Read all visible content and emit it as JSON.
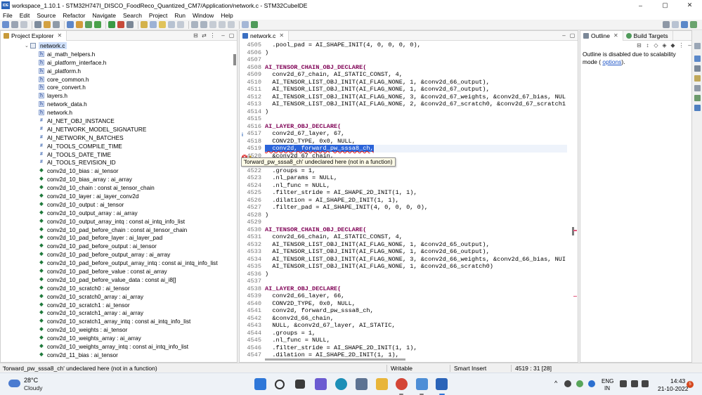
{
  "window": {
    "app_icon_label": "IDE",
    "title": "workspace_1.10.1 - STM32H747I_DISCO_FoodReco_Quantized_CM7/Application/network.c - STM32CubeIDE",
    "controls": [
      "–",
      "▢",
      "✕"
    ]
  },
  "menu": [
    "File",
    "Edit",
    "Source",
    "Refactor",
    "Navigate",
    "Search",
    "Project",
    "Run",
    "Window",
    "Help"
  ],
  "explorer": {
    "tab_label": "Project Explorer",
    "items": [
      {
        "label": "network.c",
        "kind": "file",
        "selected": true
      },
      {
        "label": "ai_math_helpers.h",
        "kind": "include"
      },
      {
        "label": "ai_platform_interface.h",
        "kind": "include"
      },
      {
        "label": "ai_platform.h",
        "kind": "include"
      },
      {
        "label": "core_common.h",
        "kind": "include"
      },
      {
        "label": "core_convert.h",
        "kind": "include"
      },
      {
        "label": "layers.h",
        "kind": "include"
      },
      {
        "label": "network_data.h",
        "kind": "include"
      },
      {
        "label": "network.h",
        "kind": "include"
      },
      {
        "label": "AI_NET_OBJ_INSTANCE",
        "kind": "macro"
      },
      {
        "label": "AI_NETWORK_MODEL_SIGNATURE",
        "kind": "macro"
      },
      {
        "label": "AI_NETWORK_N_BATCHES",
        "kind": "macro"
      },
      {
        "label": "AI_TOOLS_COMPILE_TIME",
        "kind": "macro"
      },
      {
        "label": "AI_TOOLS_DATE_TIME",
        "kind": "macro"
      },
      {
        "label": "AI_TOOLS_REVISION_ID",
        "kind": "macro"
      },
      {
        "label": "conv2d_10_bias : ai_tensor",
        "kind": "var"
      },
      {
        "label": "conv2d_10_bias_array : ai_array",
        "kind": "var"
      },
      {
        "label": "conv2d_10_chain : const ai_tensor_chain",
        "kind": "var"
      },
      {
        "label": "conv2d_10_layer : ai_layer_conv2d",
        "kind": "var"
      },
      {
        "label": "conv2d_10_output : ai_tensor",
        "kind": "var"
      },
      {
        "label": "conv2d_10_output_array : ai_array",
        "kind": "var"
      },
      {
        "label": "conv2d_10_output_array_intq : const ai_intq_info_list",
        "kind": "var"
      },
      {
        "label": "conv2d_10_pad_before_chain : const ai_tensor_chain",
        "kind": "var"
      },
      {
        "label": "conv2d_10_pad_before_layer : ai_layer_pad",
        "kind": "var"
      },
      {
        "label": "conv2d_10_pad_before_output : ai_tensor",
        "kind": "var"
      },
      {
        "label": "conv2d_10_pad_before_output_array : ai_array",
        "kind": "var"
      },
      {
        "label": "conv2d_10_pad_before_output_array_intq : const ai_intq_info_list",
        "kind": "var"
      },
      {
        "label": "conv2d_10_pad_before_value : const ai_array",
        "kind": "var"
      },
      {
        "label": "conv2d_10_pad_before_value_data : const ai_i8[]",
        "kind": "var"
      },
      {
        "label": "conv2d_10_scratch0 : ai_tensor",
        "kind": "var"
      },
      {
        "label": "conv2d_10_scratch0_array : ai_array",
        "kind": "var"
      },
      {
        "label": "conv2d_10_scratch1 : ai_tensor",
        "kind": "var"
      },
      {
        "label": "conv2d_10_scratch1_array : ai_array",
        "kind": "var"
      },
      {
        "label": "conv2d_10_scratch1_array_intq : const ai_intq_info_list",
        "kind": "var"
      },
      {
        "label": "conv2d_10_weights : ai_tensor",
        "kind": "var"
      },
      {
        "label": "conv2d_10_weights_array : ai_array",
        "kind": "var"
      },
      {
        "label": "conv2d_10_weights_array_intq : const ai_intq_info_list",
        "kind": "var"
      },
      {
        "label": "conv2d_11_bias : ai_tensor",
        "kind": "var"
      }
    ]
  },
  "editor": {
    "tab_label": "network.c",
    "hover_tooltip": "'forward_pw_sssa8_ch' undeclared here (not in a function)",
    "lines": [
      {
        "n": "4505",
        "t": "  .pool_pad = AI_SHAPE_INIT(4, 0, 0, 0, 0),"
      },
      {
        "n": "4506",
        "t": ")"
      },
      {
        "n": "4507",
        "t": ""
      },
      {
        "n": "4508",
        "t": "AI_TENSOR_CHAIN_OBJ_DECLARE("
      },
      {
        "n": "4509",
        "t": "  conv2d_67_chain, AI_STATIC_CONST, 4,"
      },
      {
        "n": "4510",
        "t": "  AI_TENSOR_LIST_OBJ_INIT(AI_FLAG_NONE, 1, &conv2d_66_output),"
      },
      {
        "n": "4511",
        "t": "  AI_TENSOR_LIST_OBJ_INIT(AI_FLAG_NONE, 1, &conv2d_67_output),"
      },
      {
        "n": "4512",
        "t": "  AI_TENSOR_LIST_OBJ_INIT(AI_FLAG_NONE, 3, &conv2d_67_weights, &conv2d_67_bias, NUL"
      },
      {
        "n": "4513",
        "t": "  AI_TENSOR_LIST_OBJ_INIT(AI_FLAG_NONE, 2, &conv2d_67_scratch0, &conv2d_67_scratch1"
      },
      {
        "n": "4514",
        "t": ")"
      },
      {
        "n": "4515",
        "t": ""
      },
      {
        "n": "4516",
        "t": "AI_LAYER_OBJ_DECLARE("
      },
      {
        "n": "4517",
        "t": "  conv2d_67_layer, 67,"
      },
      {
        "n": "4518",
        "t": "  CONV2D_TYPE, 0x0, NULL,"
      },
      {
        "n": "4519",
        "t": "  conv2d, forward_pw_sssa8_ch,"
      },
      {
        "n": "4520",
        "t": "  &conv2d_67_chain,"
      },
      {
        "n": "4521",
        "t": "  NULL, &pool_66_layer, AI_STATIC,"
      },
      {
        "n": "4522",
        "t": "  .groups = 1,"
      },
      {
        "n": "4523",
        "t": "  .nl_params = NULL,"
      },
      {
        "n": "4524",
        "t": "  .nl_func = NULL,"
      },
      {
        "n": "4525",
        "t": "  .filter_stride = AI_SHAPE_2D_INIT(1, 1),"
      },
      {
        "n": "4526",
        "t": "  .dilation = AI_SHAPE_2D_INIT(1, 1),"
      },
      {
        "n": "4527",
        "t": "  .filter_pad = AI_SHAPE_INIT(4, 0, 0, 0, 0),"
      },
      {
        "n": "4528",
        "t": ")"
      },
      {
        "n": "4529",
        "t": ""
      },
      {
        "n": "4530",
        "t": "AI_TENSOR_CHAIN_OBJ_DECLARE("
      },
      {
        "n": "4531",
        "t": "  conv2d_66_chain, AI_STATIC_CONST, 4,"
      },
      {
        "n": "4532",
        "t": "  AI_TENSOR_LIST_OBJ_INIT(AI_FLAG_NONE, 1, &conv2d_65_output),"
      },
      {
        "n": "4533",
        "t": "  AI_TENSOR_LIST_OBJ_INIT(AI_FLAG_NONE, 1, &conv2d_66_output),"
      },
      {
        "n": "4534",
        "t": "  AI_TENSOR_LIST_OBJ_INIT(AI_FLAG_NONE, 3, &conv2d_66_weights, &conv2d_66_bias, NUI"
      },
      {
        "n": "4535",
        "t": "  AI_TENSOR_LIST_OBJ_INIT(AI_FLAG_NONE, 1, &conv2d_66_scratch0)"
      },
      {
        "n": "4536",
        "t": ")"
      },
      {
        "n": "4537",
        "t": ""
      },
      {
        "n": "4538",
        "t": "AI_LAYER_OBJ_DECLARE("
      },
      {
        "n": "4539",
        "t": "  conv2d_66_layer, 66,"
      },
      {
        "n": "4540",
        "t": "  CONV2D_TYPE, 0x0, NULL,"
      },
      {
        "n": "4541",
        "t": "  conv2d, forward_pw_sssa8_ch,"
      },
      {
        "n": "4542",
        "t": "  &conv2d_66_chain,"
      },
      {
        "n": "4543",
        "t": "  NULL, &conv2d_67_layer, AI_STATIC,"
      },
      {
        "n": "4544",
        "t": "  .groups = 1,"
      },
      {
        "n": "4545",
        "t": "  .nl_func = NULL,"
      },
      {
        "n": "4546",
        "t": "  .filter_stride = AI_SHAPE_2D_INIT(1, 1),"
      },
      {
        "n": "4547",
        "t": "  .dilation = AI_SHAPE_2D_INIT(1, 1),"
      }
    ]
  },
  "outline": {
    "tab_label": "Outline",
    "build_targets_label": "Build Targets",
    "message": "Outline is disabled due to scalability mode (",
    "link_text": "options",
    "message_tail": ")."
  },
  "status": {
    "message": "'forward_pw_sssa8_ch' undeclared here (not in a function)",
    "writable": "Writable",
    "insert_mode": "Smart Insert",
    "position": "4519 : 31 [28]"
  },
  "taskbar": {
    "temperature": "28°C",
    "weather": "Cloudy",
    "lang_top": "ENG",
    "lang_bottom": "IN",
    "time": "14:43",
    "date": "21-10-2022",
    "notification_count": "5"
  },
  "colors": {
    "selection": "#2b64d9",
    "error": "#d33333",
    "link": "#1d54c7",
    "keyword": "#7f0055"
  }
}
